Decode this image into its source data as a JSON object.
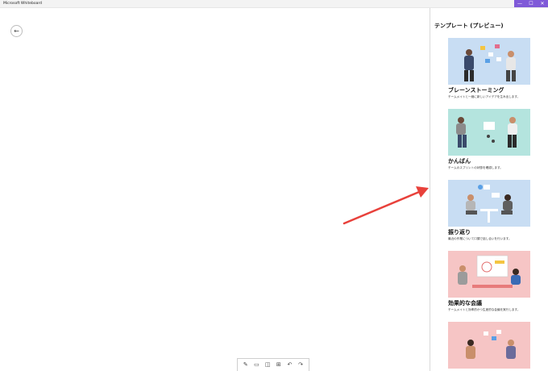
{
  "window": {
    "title": "Microsoft Whiteboard",
    "controls": {
      "minimize": "—",
      "maximize": "☐",
      "close": "✕"
    },
    "accent_color": "#7f59d8"
  },
  "canvas": {
    "back_button_icon": "←"
  },
  "panel": {
    "title": "テンプレート (プレビュー)",
    "templates": [
      {
        "name": "ブレーンストーミング",
        "desc": "チームメイトと一緒に新しいアイデアを生み出します。",
        "thumb_color": "#c8ddf3"
      },
      {
        "name": "かんばん",
        "desc": "チームのスプリントの状態を確認します。",
        "thumb_color": "#b4e4de"
      },
      {
        "name": "振り返り",
        "desc": "最近の作業について口頭で話し合いを行います。",
        "thumb_color": "#c8ddf3"
      },
      {
        "name": "効果的な会議",
        "desc": "チームメイトと効率的かつ生産的な会議を実行します。",
        "thumb_color": "#f6c5c5"
      },
      {
        "name": "",
        "desc": "",
        "thumb_color": "#f6c5c5"
      }
    ]
  },
  "toolbar": {
    "buttons": [
      {
        "icon": "✎",
        "name": "pen-icon"
      },
      {
        "icon": "▭",
        "name": "note-icon"
      },
      {
        "icon": "◫",
        "name": "insert-icon"
      },
      {
        "icon": "⊞",
        "name": "grid-icon"
      },
      {
        "icon": "↶",
        "name": "undo-icon"
      },
      {
        "icon": "↷",
        "name": "redo-icon"
      }
    ]
  },
  "annotation": {
    "arrow_color": "#e8413b"
  }
}
